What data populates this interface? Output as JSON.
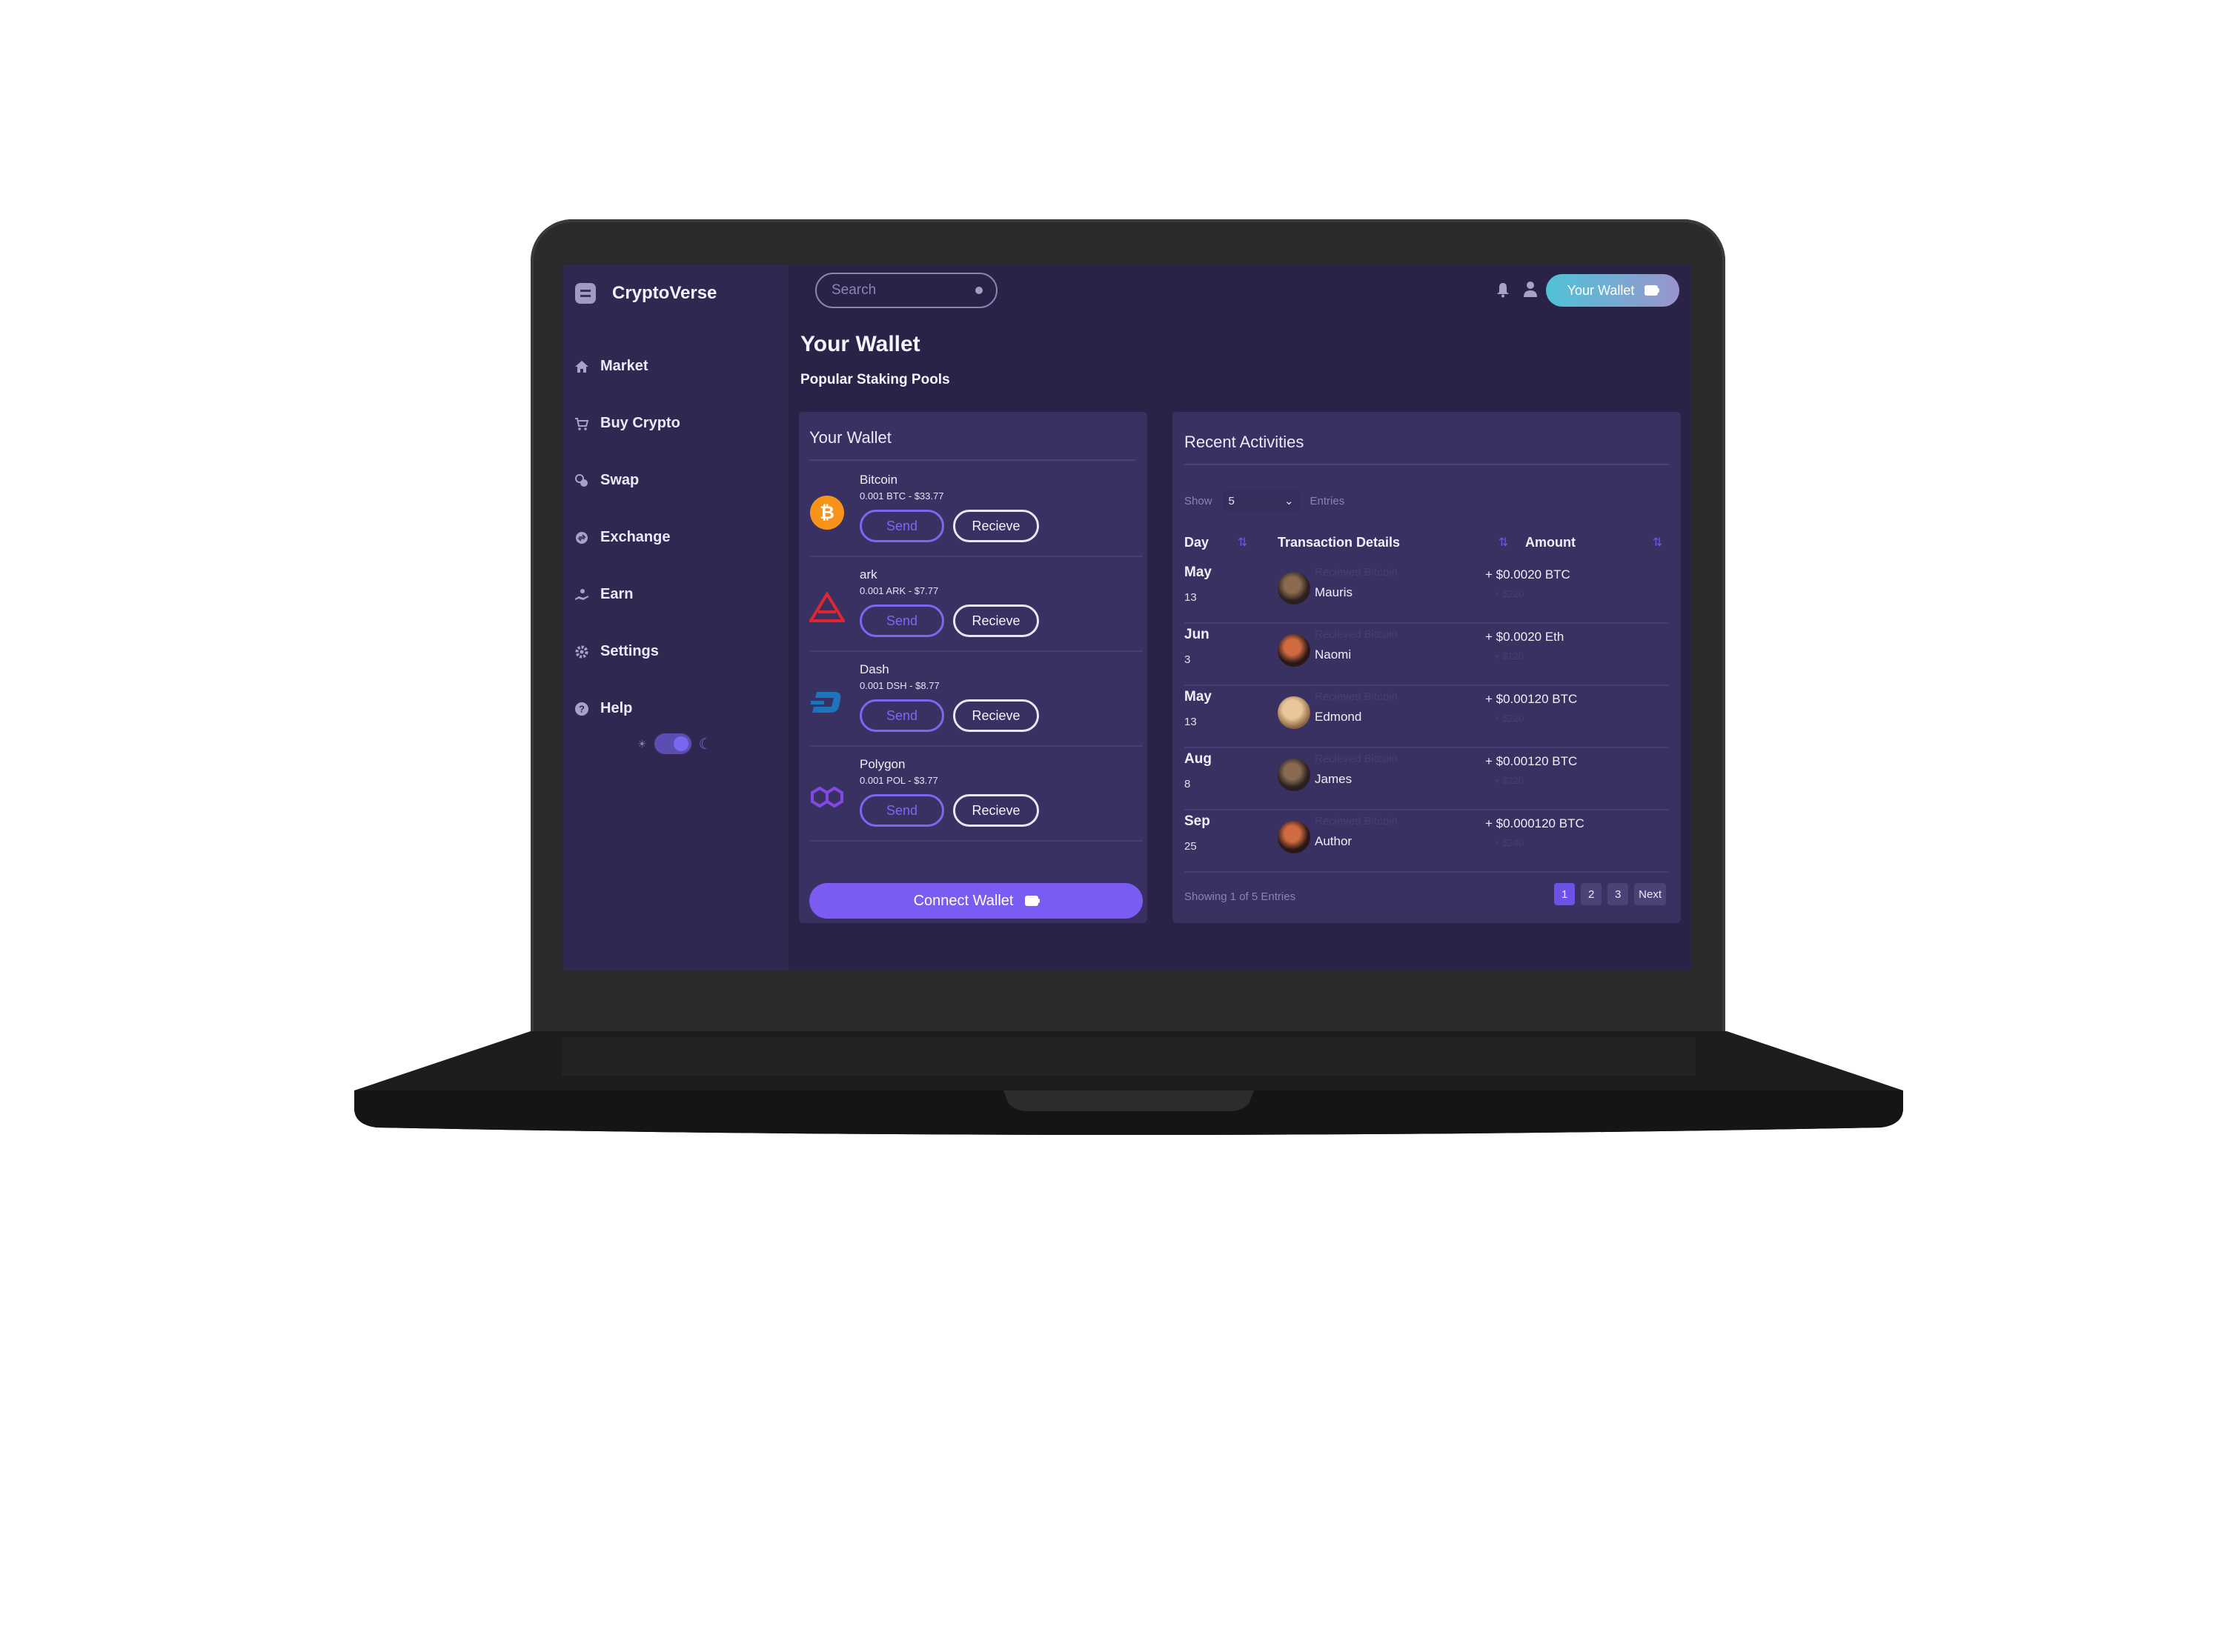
{
  "app": {
    "name": "CryptoVerse"
  },
  "header": {
    "search_placeholder": "Search",
    "wallet_button": "Your Wallet"
  },
  "sidebar": {
    "items": [
      {
        "label": "Market",
        "icon": "home-icon"
      },
      {
        "label": "Buy Crypto",
        "icon": "cart-icon"
      },
      {
        "label": "Swap",
        "icon": "swap-icon"
      },
      {
        "label": "Exchange",
        "icon": "exchange-icon"
      },
      {
        "label": "Earn",
        "icon": "earn-icon"
      },
      {
        "label": "Settings",
        "icon": "gear-icon"
      },
      {
        "label": "Help",
        "icon": "help-icon"
      }
    ],
    "theme": "dark"
  },
  "page": {
    "title": "Your Wallet",
    "subtitle": "Popular Staking Pools"
  },
  "wallet": {
    "title": "Your Wallet",
    "send_label": "Send",
    "receive_label": "Recieve",
    "connect_label": "Connect Wallet",
    "assets": [
      {
        "name": "Bitcoin",
        "detail": "0.001 BTC - $33.77",
        "icon": "bitcoin-icon",
        "color": "#f7931a"
      },
      {
        "name": "ark",
        "detail": "0.001 ARK - $7.77",
        "icon": "ark-icon",
        "color": "#e0262f"
      },
      {
        "name": "Dash",
        "detail": "0.001 DSH - $8.77",
        "icon": "dash-icon",
        "color": "#1c75bc"
      },
      {
        "name": "Polygon",
        "detail": "0.001 POL - $3.77",
        "icon": "polygon-icon",
        "color": "#8247e5"
      }
    ]
  },
  "activities": {
    "title": "Recent Activities",
    "show_label": "Show",
    "show_value": "5",
    "entries_label": "Entries",
    "columns": [
      "Day",
      "Transaction Details",
      "Amount"
    ],
    "rows": [
      {
        "month": "May",
        "day": "13",
        "type": "Recieved Bitcoin",
        "name": "Mauris",
        "amount": "+ $0.0020 BTC",
        "usd": "+ $220",
        "avatar_color": "#4a3a30"
      },
      {
        "month": "Jun",
        "day": "3",
        "type": "Recieved Bitcoin",
        "name": "Naomi",
        "amount": "+ $0.0020 Eth",
        "usd": "+ $120",
        "avatar_color": "#7a3226"
      },
      {
        "month": "May",
        "day": "13",
        "type": "Recieved Bitcoin",
        "name": "Edmond",
        "amount": "+ $0.00120 BTC",
        "usd": "+ $220",
        "avatar_color": "#c0a070"
      },
      {
        "month": "Aug",
        "day": "8",
        "type": "Recieved Bitcoin",
        "name": "James",
        "amount": "+ $0.00120 BTC",
        "usd": "+ $220",
        "avatar_color": "#4a3a30"
      },
      {
        "month": "Sep",
        "day": "25",
        "type": "Recieved Bitcoin",
        "name": "Author",
        "amount": "+ $0.000120 BTC",
        "usd": "+ $240",
        "avatar_color": "#7a3226"
      }
    ],
    "footer": "Showing 1 of 5 Entries",
    "pages": [
      "1",
      "2",
      "3"
    ],
    "next_label": "Next"
  }
}
